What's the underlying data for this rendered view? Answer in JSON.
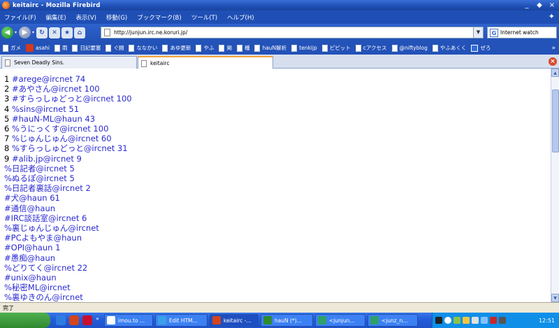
{
  "window": {
    "title": "keitairc - Mozilla Firebird",
    "controls": [
      "_",
      "◆",
      "×"
    ]
  },
  "menubar": {
    "items": [
      "ファイル(F)",
      "編集(E)",
      "表示(V)",
      "移動(G)",
      "ブックマーク(B)",
      "ツール(T)",
      "ヘルプ(H)"
    ]
  },
  "navigation": {
    "url": "http://junjun.irc.ne.koruri.jp/",
    "search_placeholder": "Internet watch",
    "search_engine_icon": "G"
  },
  "bookmarks": [
    {
      "label": "ガメ",
      "icon": "page"
    },
    {
      "label": "asahi",
      "icon": "asahi"
    },
    {
      "label": "雨",
      "icon": "page"
    },
    {
      "label": "日記要塞",
      "icon": "page"
    },
    {
      "label": "ぐ闘",
      "icon": "page"
    },
    {
      "label": "ななかい",
      "icon": "page"
    },
    {
      "label": "あゆ更新",
      "icon": "page"
    },
    {
      "label": "やふ",
      "icon": "page"
    },
    {
      "label": "掲",
      "icon": "page"
    },
    {
      "label": "種",
      "icon": "page"
    },
    {
      "label": "hauN解析",
      "icon": "page"
    },
    {
      "label": "tenkijp",
      "icon": "page"
    },
    {
      "label": "ピピット",
      "icon": "page"
    },
    {
      "label": "cアクセス",
      "icon": "page"
    },
    {
      "label": "@niftyblog",
      "icon": "page"
    },
    {
      "label": "やふあくく",
      "icon": "page"
    },
    {
      "label": "ぜろ",
      "icon": "blue"
    }
  ],
  "tabs": [
    {
      "label": "Seven Deadly Sins.",
      "active": false
    },
    {
      "label": "keitairc",
      "active": true
    }
  ],
  "channels": [
    {
      "num": "1",
      "name": "#arege@ircnet 74"
    },
    {
      "num": "2",
      "name": "#あやさん@ircnet 100"
    },
    {
      "num": "3",
      "name": "#すらっしゅどっと@ircnet 100"
    },
    {
      "num": "4",
      "name": "%sins@ircnet 51"
    },
    {
      "num": "5",
      "name": "#hauN-ML@haun 43"
    },
    {
      "num": "6",
      "name": "%うにっくす@ircnet 100"
    },
    {
      "num": "7",
      "name": "%じゅんじゅん@ircnet 60"
    },
    {
      "num": "8",
      "name": "%すらっしゅどっと@ircnet 31"
    },
    {
      "num": "9",
      "name": "#alib.jp@ircnet 9"
    },
    {
      "num": "",
      "name": "%日記者@ircnet 5"
    },
    {
      "num": "",
      "name": "%ぬるぽ@ircnet 5"
    },
    {
      "num": "",
      "name": "%日記者裏話@ircnet 2"
    },
    {
      "num": "",
      "name": "#犬@haun 61"
    },
    {
      "num": "",
      "name": "#通信@haun"
    },
    {
      "num": "",
      "name": "#IRC談話室@ircnet 6"
    },
    {
      "num": "",
      "name": "%裏じゅんじゅん@ircnet"
    },
    {
      "num": "",
      "name": "#PCよもやま@haun"
    },
    {
      "num": "",
      "name": "#OPI@haun 1"
    },
    {
      "num": "",
      "name": "#愚痴@haun"
    },
    {
      "num": "",
      "name": "%どりてく@ircnet 22"
    },
    {
      "num": "",
      "name": "#unix@haun"
    },
    {
      "num": "",
      "name": "%秘密ML@ircnet"
    },
    {
      "num": "",
      "name": "%裏ゆきのん@ircnet"
    }
  ],
  "status": {
    "text": "完了"
  },
  "taskbar": {
    "tasks": [
      {
        "label": "imou.to ...",
        "color": "#ffffff"
      },
      {
        "label": "Edit HTM...",
        "color": "#3aa0e8"
      },
      {
        "label": "keitairc -...",
        "color": "#d2451e",
        "active": true
      },
      {
        "label": "hauN (*)...",
        "color": "#2f8a2f"
      },
      {
        "label": "<junjun...",
        "color": "#2fa06a"
      },
      {
        "label": "<junz_n...",
        "color": "#2fa06a"
      }
    ],
    "clock": "12:51"
  },
  "colors": {
    "link": "#2a2ad4",
    "titlebar": "#1f4fb5",
    "taskbar": "#245edb"
  }
}
